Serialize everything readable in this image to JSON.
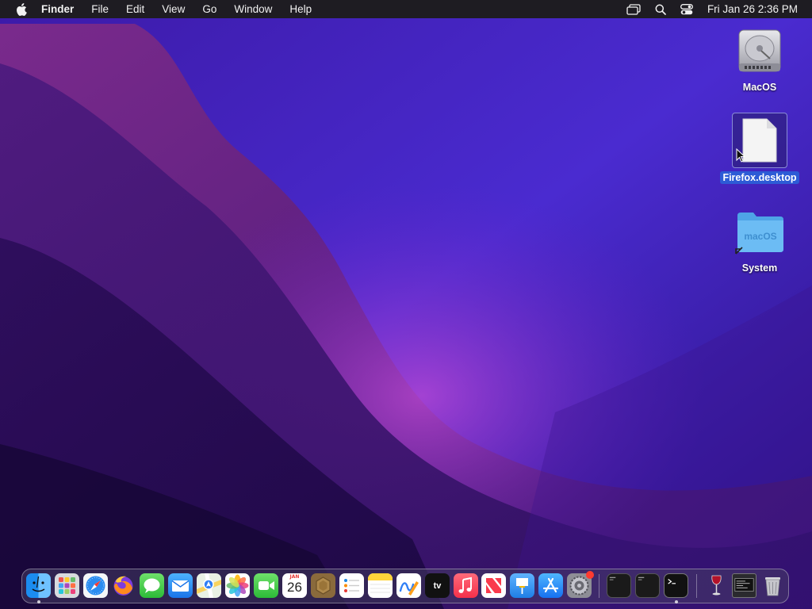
{
  "menubar": {
    "app_name": "Finder",
    "menus": [
      "File",
      "Edit",
      "View",
      "Go",
      "Window",
      "Help"
    ],
    "clock": "Fri Jan 26  2:36 PM",
    "status_icons": [
      "screen-mirroring-icon",
      "spotlight-search-icon",
      "control-center-icon"
    ]
  },
  "desktop": {
    "icons": [
      {
        "label": "MacOS",
        "icon": "hard-drive-icon",
        "selected": false
      },
      {
        "label": "Firefox.desktop",
        "icon": "document-icon",
        "selected": true
      },
      {
        "label": "System",
        "icon": "folder-alias-icon",
        "selected": false,
        "folder_text": "macOS"
      }
    ]
  },
  "dock": {
    "apps": [
      "Finder",
      "Launchpad",
      "Safari",
      "Firefox",
      "Messages",
      "Mail",
      "Maps",
      "Photos",
      "FaceTime",
      "Calendar",
      "Archive Utility",
      "Reminders",
      "Notes",
      "Freeform",
      "Apple TV",
      "Music",
      "News",
      "Keynote",
      "App Store",
      "System Settings",
      "Terminal Window 1",
      "Terminal Window 2",
      "Terminal",
      "Wine",
      "Console",
      "Trash"
    ],
    "calendar": {
      "month": "JAN",
      "day": "26"
    },
    "tv_label": "tv"
  },
  "colors": {
    "menubar": "#1e1c22",
    "selection": "#2d5bd6",
    "folder": "#5fb4f2",
    "wallpaper_base": "#2a1170",
    "badge": "#ff3b30"
  }
}
